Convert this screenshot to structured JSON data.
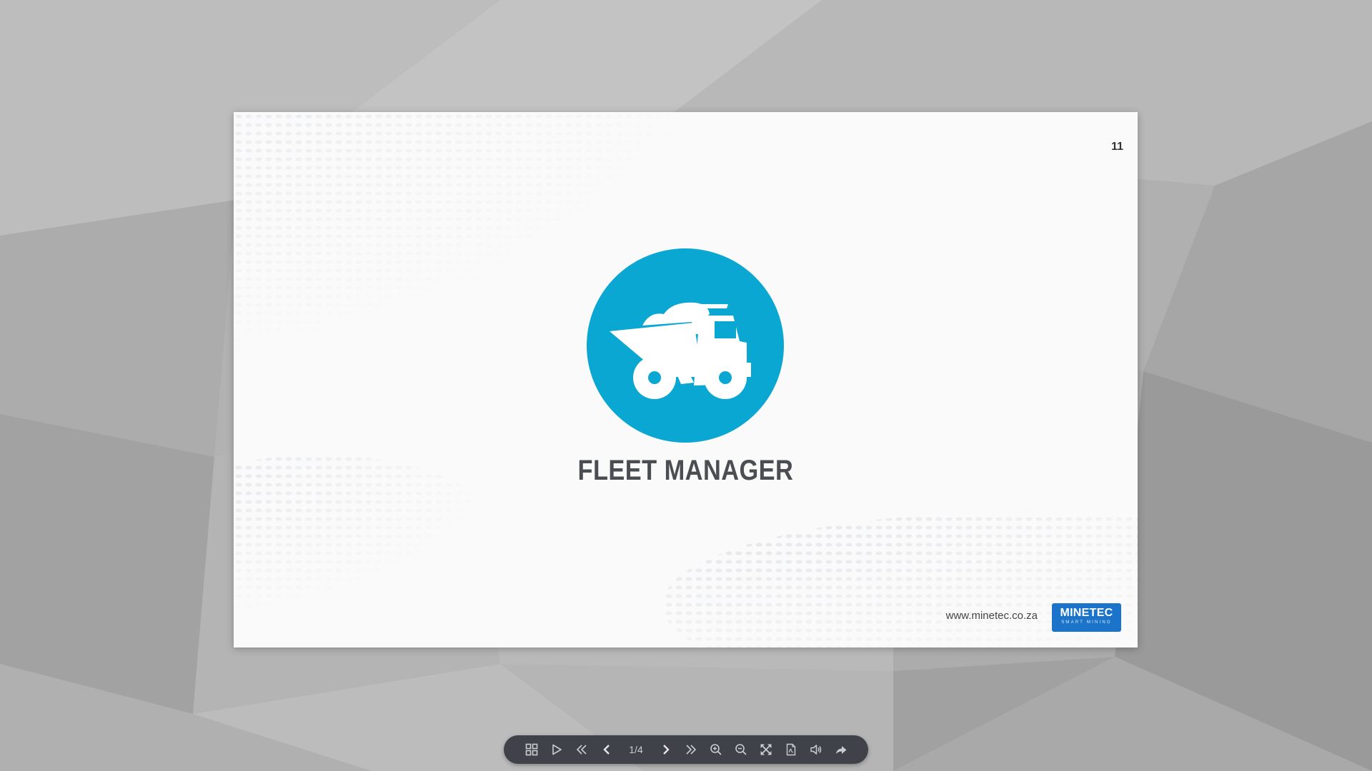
{
  "slide": {
    "page_number": "11",
    "title": "FLEET MANAGER",
    "hero_icon": "dump-truck-icon",
    "website": "www.minetec.co.za",
    "brand": {
      "name": "MINETEC",
      "tagline": "SMART MINING",
      "color": "#1b74c9"
    },
    "accent_color": "#0aa7d2"
  },
  "toolbar": {
    "page_indicator": "1/4",
    "buttons": [
      {
        "name": "thumbnails-button",
        "icon": "grid-icon"
      },
      {
        "name": "autoplay-button",
        "icon": "play-icon"
      },
      {
        "name": "first-page-button",
        "icon": "double-chevron-left-icon"
      },
      {
        "name": "previous-page-button",
        "icon": "chevron-left-icon"
      },
      {
        "name": "next-page-button",
        "icon": "chevron-right-icon"
      },
      {
        "name": "last-page-button",
        "icon": "double-chevron-right-icon"
      },
      {
        "name": "zoom-in-button",
        "icon": "zoom-in-icon"
      },
      {
        "name": "zoom-out-button",
        "icon": "zoom-out-icon"
      },
      {
        "name": "fullscreen-button",
        "icon": "fullscreen-icon"
      },
      {
        "name": "download-pdf-button",
        "icon": "pdf-icon"
      },
      {
        "name": "sound-button",
        "icon": "speaker-icon"
      },
      {
        "name": "share-button",
        "icon": "share-icon"
      }
    ]
  }
}
